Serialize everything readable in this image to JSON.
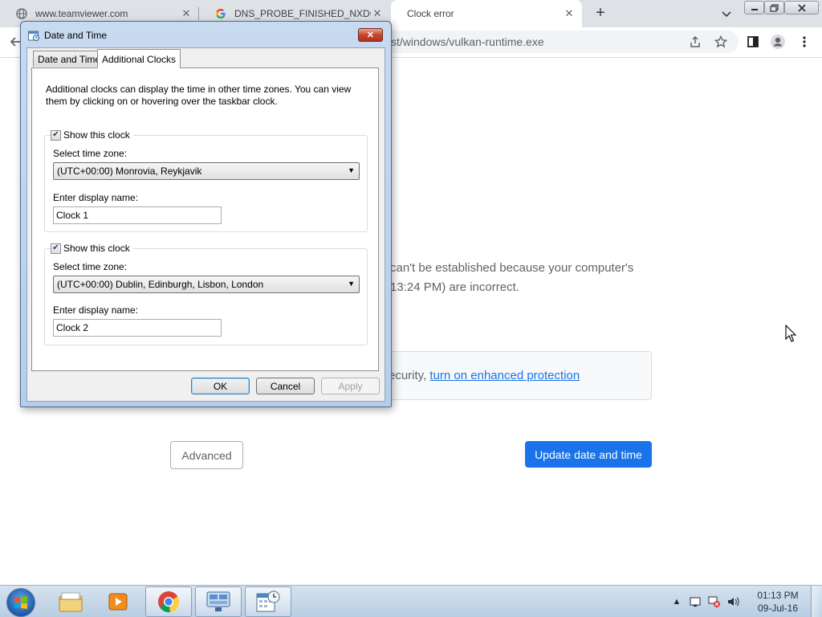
{
  "browser": {
    "tabs": [
      {
        "title": "www.teamviewer.com",
        "icon": "globe-icon"
      },
      {
        "title": "DNS_PROBE_FINISHED_NXDOMAIN",
        "icon": "google-icon"
      },
      {
        "title": "Clock error",
        "icon": "none"
      }
    ],
    "new_tab_label": "+",
    "url_fragment": "st/windows/vulkan-runtime.exe"
  },
  "page": {
    "error_line1": "can't be established because your computer's",
    "error_line2": "13:24 PM) are incorrect.",
    "security_prefix": "ecurity, ",
    "security_link": "turn on enhanced protection",
    "advanced_button": "Advanced",
    "update_button": "Update date and time"
  },
  "dialog": {
    "title": "Date and Time",
    "tabs": [
      "Date and Time",
      "Additional Clocks"
    ],
    "active_tab": "Additional Clocks",
    "description": "Additional clocks can display the time in other time zones. You can view them by clicking on or hovering over the taskbar clock.",
    "clocks": [
      {
        "show_label": "Show this clock",
        "checked": true,
        "tz_label": "Select time zone:",
        "tz_value": "(UTC+00:00) Monrovia, Reykjavik",
        "name_label": "Enter display name:",
        "name_value": "Clock 1"
      },
      {
        "show_label": "Show this clock",
        "checked": true,
        "tz_label": "Select time zone:",
        "tz_value": "(UTC+00:00) Dublin, Edinburgh, Lisbon, London",
        "name_label": "Enter display name:",
        "name_value": "Clock 2"
      }
    ],
    "buttons": {
      "ok": "OK",
      "cancel": "Cancel",
      "apply": "Apply"
    }
  },
  "taskbar": {
    "apps": [
      "windows-explorer-icon",
      "media-player-icon",
      "chrome-icon",
      "network-app-icon",
      "date-time-control-panel-icon"
    ],
    "clock_time": "01:13 PM",
    "clock_date": "09-Jul-16"
  },
  "colors": {
    "link_blue": "#1a73e8",
    "primary_button": "#1a73e8",
    "dialog_frame": "#b6cde8",
    "taskbar": "#c4d5e8"
  }
}
